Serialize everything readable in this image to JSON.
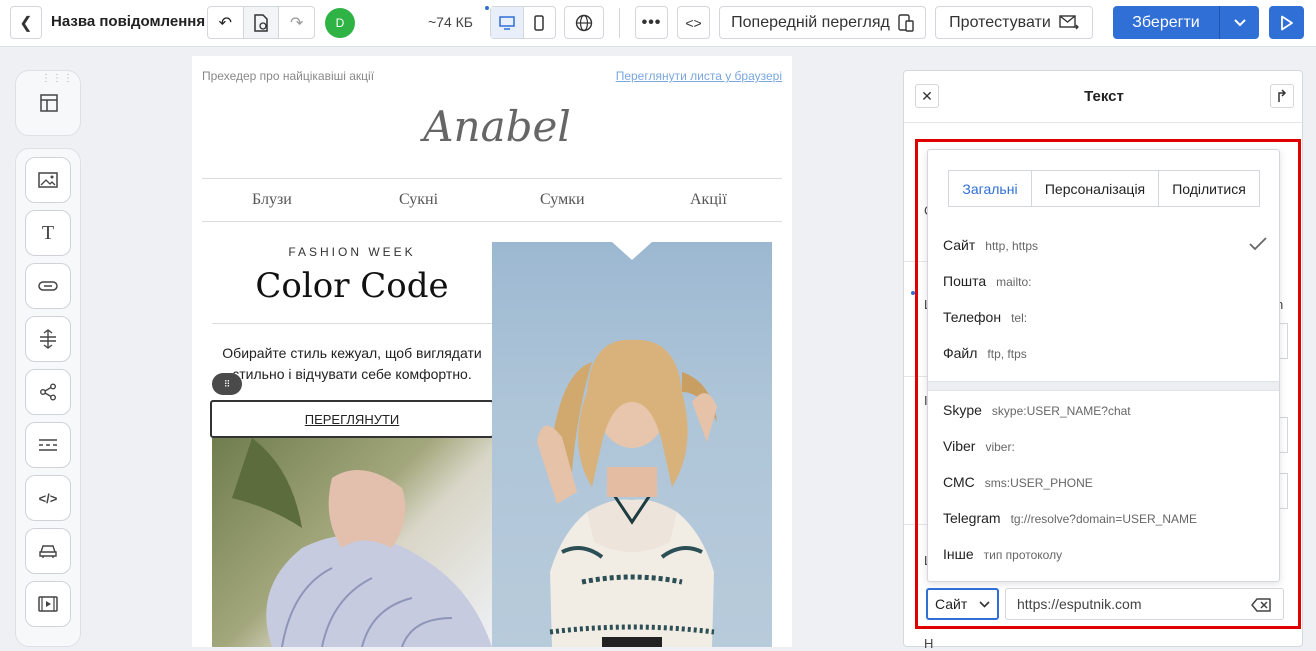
{
  "header": {
    "message_name": "Назва повідомлення",
    "avatar_letter": "D",
    "size": "~74 КБ",
    "preview_label": "Попередній перегляд",
    "test_label": "Протестувати",
    "save_label": "Зберегти"
  },
  "email": {
    "preheader": "Прехедер про найцікавіші акції",
    "browser_link": "Переглянути листа у браузері",
    "logo": "Anabel",
    "nav": [
      "Блузи",
      "Сукні",
      "Сумки",
      "Акції"
    ],
    "kicker": "FASHION WEEK",
    "headline": "Color Code",
    "body": "Обирайте стиль кежуал, щоб виглядати стильно і відчувати себе комфортно.",
    "cta": "ПЕРЕГЛЯНУТИ"
  },
  "panel": {
    "title": "Текст",
    "tabs": [
      "Загальні",
      "Персоналізація",
      "Поділитися"
    ],
    "active_tab": "Загальні",
    "protocols": [
      {
        "name": "Сайт",
        "prefix": "http, https",
        "selected": true
      },
      {
        "name": "Пошта",
        "prefix": "mailto:"
      },
      {
        "name": "Телефон",
        "prefix": "tel:"
      },
      {
        "name": "Файл",
        "prefix": "ftp, ftps"
      },
      {
        "name": "Skype",
        "prefix": "skype:USER_NAME?chat"
      },
      {
        "name": "Viber",
        "prefix": "viber:"
      },
      {
        "name": "СМС",
        "prefix": "sms:USER_PHONE"
      },
      {
        "name": "Telegram",
        "prefix": "tg://resolve?domain=USER_NAME"
      },
      {
        "name": "Інше",
        "prefix": "тип протоколу"
      }
    ],
    "select_value": "Сайт",
    "url_value": "https://esputnik.com"
  },
  "colors": {
    "accent": "#2f6fd6",
    "highlight": "#e00000",
    "avatar": "#2fb344"
  },
  "icons": [
    "back-icon",
    "undo-icon",
    "version-icon",
    "redo-icon",
    "desktop-icon",
    "mobile-icon",
    "globe-icon",
    "more-icon",
    "code-icon",
    "preview-icon",
    "send-icon",
    "chevron-down-icon",
    "play-icon",
    "close-icon",
    "collapse-icon",
    "check-icon",
    "clear-icon"
  ]
}
